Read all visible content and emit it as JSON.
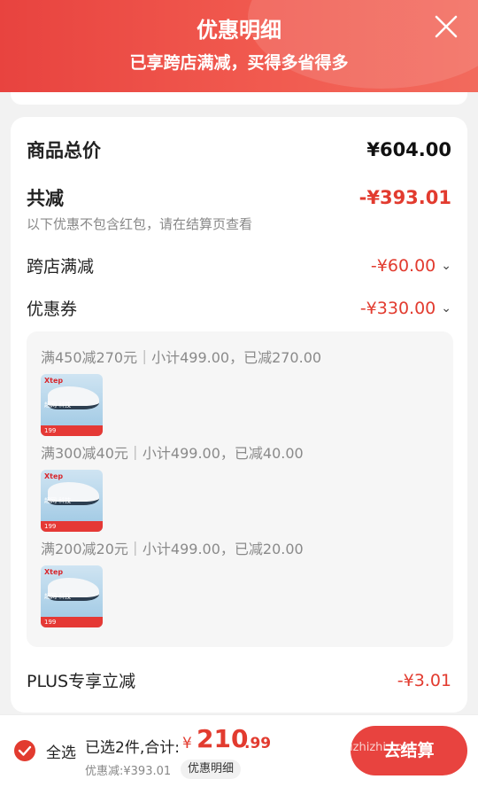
{
  "header": {
    "title": "优惠明细",
    "subtitle": "已享跨店满减，买得多省得多"
  },
  "summary": {
    "total_label": "商品总价",
    "total_value": "¥604.00",
    "reduce_label": "共减",
    "reduce_value": "-¥393.01",
    "note": "以下优惠不包含红包，请在结算页查看"
  },
  "discounts": {
    "cross_store_label": "跨店满减",
    "cross_store_value": "-¥60.00",
    "coupon_label": "优惠券",
    "coupon_value": "-¥330.00",
    "plus_label": "PLUS专享立减",
    "plus_value": "-¥3.01"
  },
  "coupons": [
    {
      "text": "满450减270元｜小计499.00，已减270.00"
    },
    {
      "text": "满300减40元｜小计499.00，已减40.00"
    },
    {
      "text": "满200减20元｜小计499.00，已减20.00"
    }
  ],
  "product_thumb": {
    "brand": "Xtep",
    "caption": "超网 科技",
    "price_tag": "199"
  },
  "bottom": {
    "select_all": "全选",
    "selected_text": "已选2件,合计:",
    "currency": "¥",
    "total_int": "210",
    "total_dec": ".99",
    "discount_text": "优惠减:¥393.01",
    "detail_btn": "优惠明细",
    "checkout_btn": "去结算"
  },
  "watermark": "zhizhizhi.com",
  "colors": {
    "accent": "#e8433f",
    "price_red": "#e23b2f"
  }
}
